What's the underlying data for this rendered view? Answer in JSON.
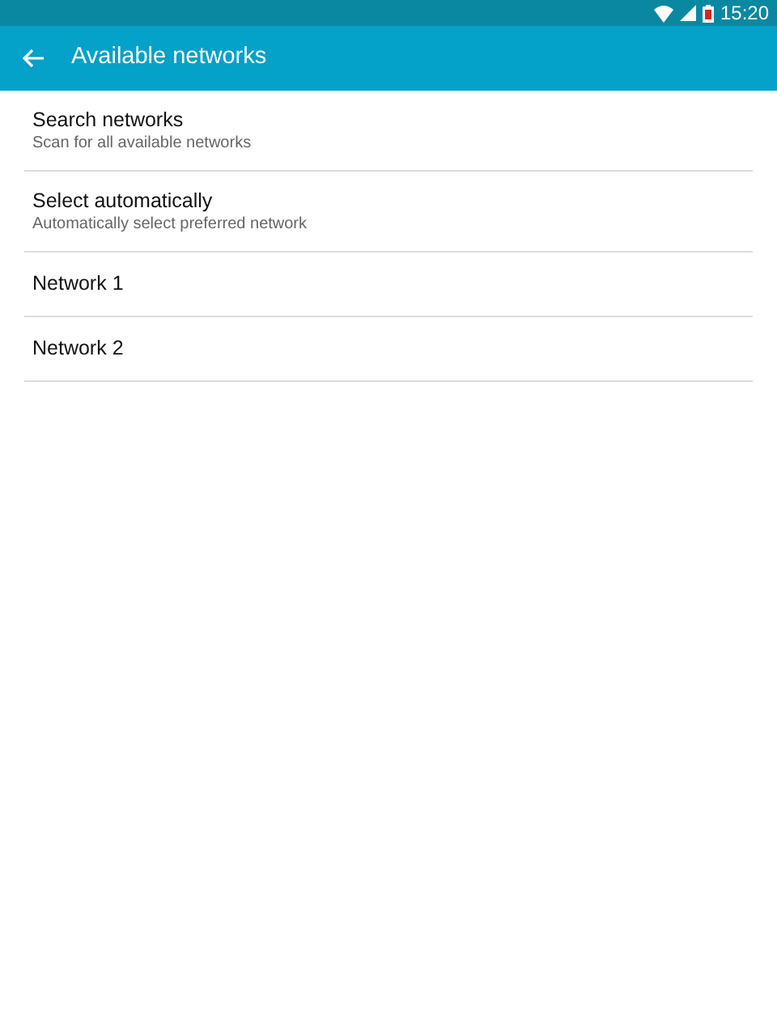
{
  "status_bar": {
    "time": "15:20"
  },
  "app_bar": {
    "title": "Available networks"
  },
  "items": [
    {
      "title": "Search networks",
      "subtitle": "Scan for all available networks"
    },
    {
      "title": "Select automatically",
      "subtitle": "Automatically select preferred network"
    },
    {
      "title": "Network 1"
    },
    {
      "title": "Network 2"
    }
  ]
}
